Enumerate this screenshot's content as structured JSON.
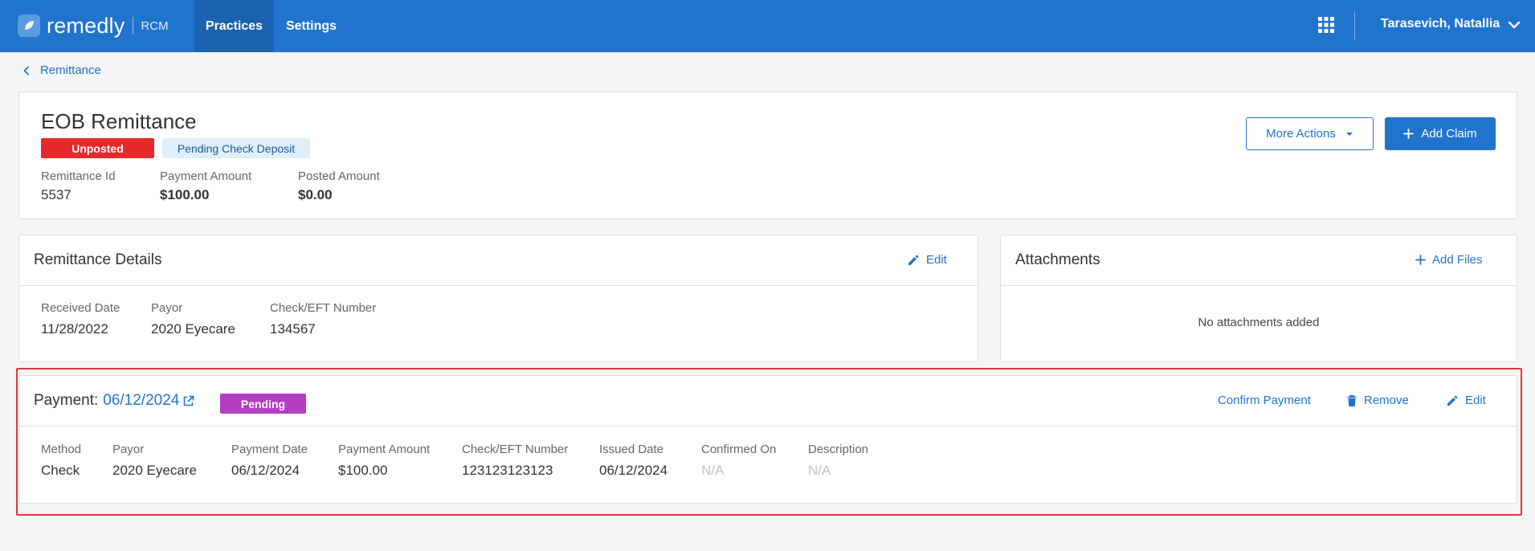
{
  "app": {
    "logo_text": "remedly",
    "logo_sub": "RCM",
    "nav": [
      {
        "label": "Practices"
      },
      {
        "label": "Settings"
      }
    ],
    "user_name": "Tarasevich, Natallia",
    "colors": {
      "brand": "#2174cd",
      "nav_active": "#1b62b0"
    }
  },
  "breadcrumb": {
    "label": "Remittance"
  },
  "header": {
    "title": "EOB Remittance",
    "badges": {
      "status": {
        "label": "Unposted",
        "color": "#e62a2a"
      },
      "deposit": {
        "label": "Pending Check Deposit",
        "color": "#e1effb"
      }
    },
    "fields": [
      {
        "label": "Remittance Id",
        "value": "5537"
      },
      {
        "label": "Payment Amount",
        "value": "$100.00"
      },
      {
        "label": "Posted Amount",
        "value": "$0.00"
      }
    ],
    "more_actions_label": "More Actions",
    "add_claim_label": "Add Claim"
  },
  "remittance_details": {
    "title": "Remittance Details",
    "edit_label": "Edit",
    "fields": [
      {
        "label": "Received Date",
        "value": "11/28/2022"
      },
      {
        "label": "Payor",
        "value": "2020 Eyecare"
      },
      {
        "label": "Check/EFT Number",
        "value": "134567"
      }
    ]
  },
  "attachments": {
    "title": "Attachments",
    "add_files_label": "Add Files",
    "empty_text": "No attachments added"
  },
  "payment": {
    "title_prefix": "Payment:",
    "date_link": "06/12/2024",
    "badge": {
      "label": "Pending",
      "color": "#b53dc6"
    },
    "actions": {
      "confirm": "Confirm Payment",
      "remove": "Remove",
      "edit": "Edit"
    },
    "fields": [
      {
        "label": "Method",
        "value": "Check"
      },
      {
        "label": "Payor",
        "value": "2020 Eyecare"
      },
      {
        "label": "Payment Date",
        "value": "06/12/2024"
      },
      {
        "label": "Payment Amount",
        "value": "$100.00"
      },
      {
        "label": "Check/EFT Number",
        "value": "123123123123"
      },
      {
        "label": "Issued Date",
        "value": "06/12/2024"
      },
      {
        "label": "Confirmed On",
        "value": "N/A"
      },
      {
        "label": "Description",
        "value": "N/A"
      }
    ],
    "highlight_color": "#e0373e"
  },
  "icons": {
    "logo": "leaf-logo-icon",
    "apps": "grid-icon",
    "user_menu": "chevron-down-icon",
    "back": "chevron-left-icon",
    "dropdown": "caret-down-icon",
    "add": "plus-icon",
    "edit": "pencil-icon",
    "external": "external-link-icon",
    "remove": "trash-icon"
  }
}
